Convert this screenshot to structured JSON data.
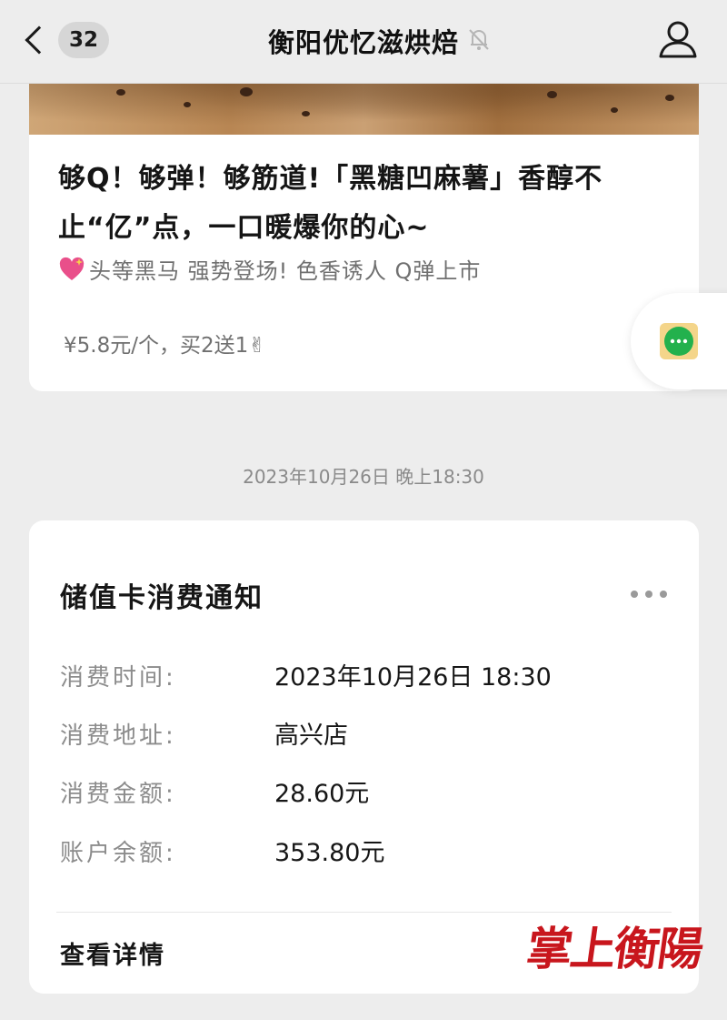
{
  "header": {
    "back_label": "<",
    "unread_count": "32",
    "title": "衡阳优忆滋烘焙",
    "mute_icon": "bell-off-icon",
    "profile_icon": "person-icon"
  },
  "article": {
    "title": "够Q！够弹！够筋道!「黑糖凹麻薯」香醇不止“亿”点，一口暖爆你的心~",
    "subtitle": "头等黑马 强势登场! 色香诱人 Q弹上市",
    "subtitle_icon": "sparkling-heart-icon",
    "price": "¥5.8元/个，买2送1✌"
  },
  "floating_button": {
    "icon": "more-chat-icon"
  },
  "timestamp": "2023年10月26日 晚上18:30",
  "notice": {
    "title": "储值卡消费通知",
    "more_icon": "more-dots-icon",
    "fields": [
      {
        "label": "消费时间:",
        "value": "2023年10月26日 18:30"
      },
      {
        "label": "消费地址:",
        "value": "高兴店"
      },
      {
        "label": "消费金额:",
        "value": "28.60元"
      },
      {
        "label": "账户余额:",
        "value": "353.80元"
      }
    ],
    "detail_link": "查看详情"
  },
  "watermark": "掌上衡陽",
  "colors": {
    "background": "#ededed",
    "card": "#ffffff",
    "label": "#8c8c8c",
    "accent_green": "#23b14d",
    "watermark_red": "#c8161d"
  }
}
